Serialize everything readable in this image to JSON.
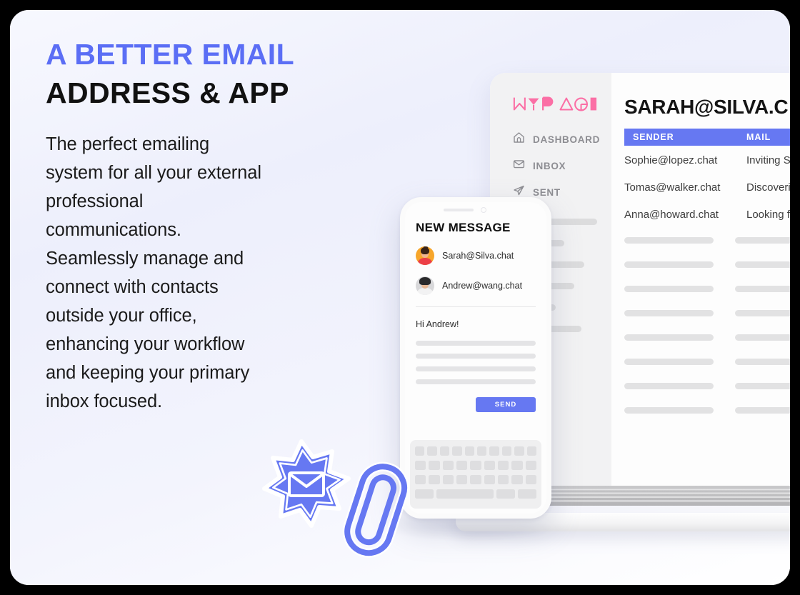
{
  "theme": {
    "accent_blue": "#6678f2",
    "heading_blue": "#5b6ef5",
    "logo_pink": "#fb6fa5",
    "text_dark": "#111111",
    "card_bg": "#ffffff",
    "page_bg": "#000000"
  },
  "copy": {
    "headline_line1": "A BETTER EMAIL",
    "headline_line2": "ADDRESS & APP",
    "body": "The perfect emailing\nsystem for all your external\nprofessional\ncommunications.\nSeamlessly manage and\nconnect with contacts\noutside your office,\nenhancing your workflow\nand keeping your primary\ninbox focused."
  },
  "laptop": {
    "sidebar": {
      "logo_text": "MYPAGE",
      "nav": [
        {
          "label": "DASHBOARD",
          "icon": "home-icon"
        },
        {
          "label": "INBOX",
          "icon": "envelope-icon"
        },
        {
          "label": "SENT",
          "icon": "paper-plane-icon"
        }
      ],
      "placeholder_bar_widths": [
        118,
        72,
        100,
        86,
        60,
        96
      ]
    },
    "main": {
      "title": "SARAH@SILVA.C",
      "columns": [
        "SENDER",
        "MAIL"
      ],
      "rows": [
        {
          "sender": "Sophie@lopez.chat",
          "mail": "Inviting Sa"
        },
        {
          "sender": "Tomas@walker.chat",
          "mail": "Discoverin"
        },
        {
          "sender": "Anna@howard.chat",
          "mail": "Looking fo"
        }
      ],
      "placeholder_row_count": 8
    }
  },
  "phone": {
    "title": "NEW MESSAGE",
    "recipients": [
      {
        "address": "Sarah@Silva.chat",
        "avatar": "avatar-sarah"
      },
      {
        "address": "Andrew@wang.chat",
        "avatar": "avatar-andrew"
      }
    ],
    "greeting": "Hi Andrew!",
    "message_line_count": 4,
    "send_label": "SEND",
    "keyboard_rows": [
      10,
      9,
      9,
      4
    ]
  },
  "badges": [
    {
      "name": "starburst-envelope-badge",
      "icon": "envelope-icon"
    },
    {
      "name": "paperclip-badge",
      "icon": "paperclip-icon"
    }
  ]
}
